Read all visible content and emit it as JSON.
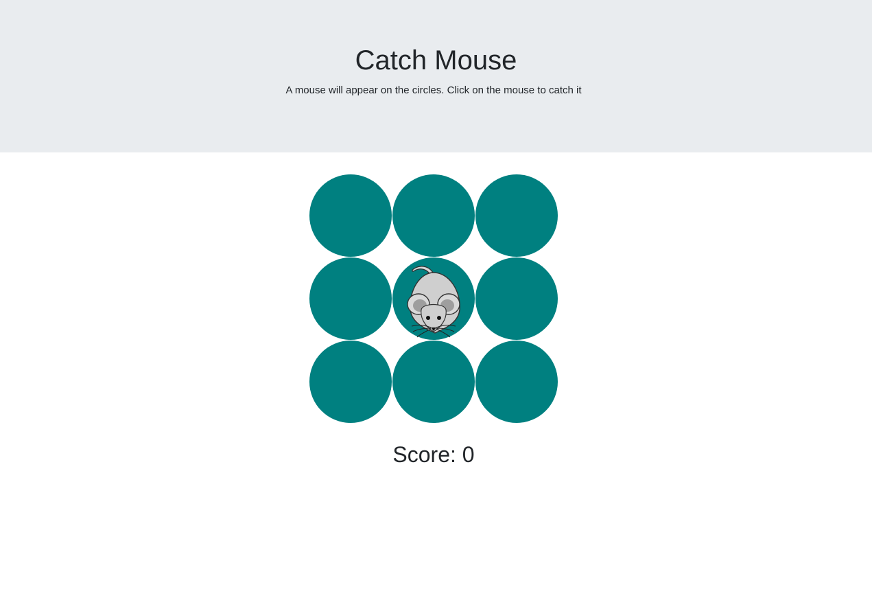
{
  "header": {
    "title": "Catch Mouse",
    "subtitle": "A mouse will appear on the circles. Click on the mouse to catch it"
  },
  "board": {
    "rows": 3,
    "cols": 3,
    "hole_color": "#008080",
    "mouse_hole_index": 4,
    "mouse_icon": "mouse-icon"
  },
  "score": {
    "text": "Score: 0",
    "value": 0
  },
  "colors": {
    "header_background": "#e9ecef",
    "text": "#212529",
    "hole": "#008080"
  }
}
